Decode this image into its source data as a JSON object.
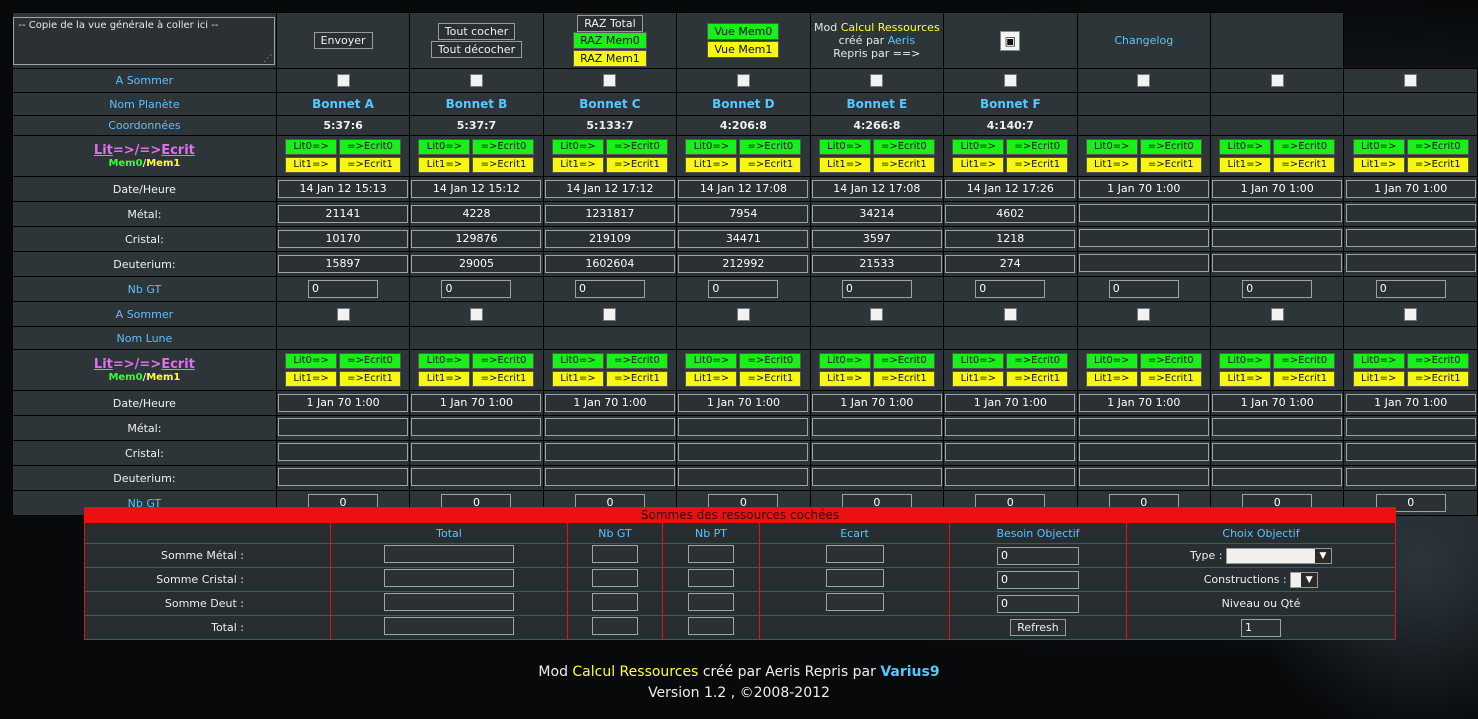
{
  "top": {
    "paste_placeholder": "-- Copie de la vue générale à coller ici --",
    "send": "Envoyer",
    "check_all": "Tout cocher",
    "uncheck_all": "Tout décocher",
    "raz_total": "RAZ Total",
    "raz_mem0": "RAZ Mem0",
    "raz_mem1": "RAZ Mem1",
    "vue_mem0": "Vue Mem0",
    "vue_mem1": "Vue Mem1",
    "mod_word": "Mod",
    "mod_name": "Calcul Ressources",
    "created_by": "créé par",
    "author": "Aeris",
    "taken_by": "Repris par ==>",
    "changelog": "Changelog",
    "export_icon": "image-icon"
  },
  "labels": {
    "sum": "A Sommer",
    "planet_name": "Nom Planète",
    "coords": "Coordonnées",
    "lit": "Lit",
    "arrows": "=>/=>",
    "ecrit": "Ecrit",
    "mem0": "Mem0",
    "slash": "/",
    "mem1": "Mem1",
    "date": "Date/Heure",
    "metal": "Métal:",
    "crystal": "Cristal:",
    "deut": "Deuterium:",
    "nbgt": "Nb GT",
    "moon_name": "Nom Lune"
  },
  "mem_buttons": {
    "lit0": "Lit0=>",
    "ecrit0": "=>Ecrit0",
    "lit1": "Lit1=>",
    "ecrit1": "=>Ecrit1"
  },
  "planets": [
    {
      "name": "Bonnet A",
      "coords": "5:37:6",
      "date": "14 Jan 12  15:13",
      "metal": "21141",
      "crystal": "10170",
      "deut": "15897",
      "nbgt": "0"
    },
    {
      "name": "Bonnet B",
      "coords": "5:37:7",
      "date": "14 Jan 12  15:12",
      "metal": "4228",
      "crystal": "129876",
      "deut": "29005",
      "nbgt": "0"
    },
    {
      "name": "Bonnet C",
      "coords": "5:133:7",
      "date": "14 Jan 12  17:12",
      "metal": "1231817",
      "crystal": "219109",
      "deut": "1602604",
      "nbgt": "0"
    },
    {
      "name": "Bonnet D",
      "coords": "4:206:8",
      "date": "14 Jan 12  17:08",
      "metal": "7954",
      "crystal": "34471",
      "deut": "212992",
      "nbgt": "0"
    },
    {
      "name": "Bonnet E",
      "coords": "4:266:8",
      "date": "14 Jan 12  17:08",
      "metal": "34214",
      "crystal": "3597",
      "deut": "21533",
      "nbgt": "0"
    },
    {
      "name": "Bonnet F",
      "coords": "4:140:7",
      "date": "14 Jan 12  17:26",
      "metal": "4602",
      "crystal": "1218",
      "deut": "274",
      "nbgt": "0"
    },
    {
      "name": "",
      "coords": "",
      "date": "1 Jan 70  1:00",
      "metal": "",
      "crystal": "",
      "deut": "",
      "nbgt": "0"
    },
    {
      "name": "",
      "coords": "",
      "date": "1 Jan 70  1:00",
      "metal": "",
      "crystal": "",
      "deut": "",
      "nbgt": "0"
    },
    {
      "name": "",
      "coords": "",
      "date": "1 Jan 70  1:00",
      "metal": "",
      "crystal": "",
      "deut": "",
      "nbgt": "0"
    }
  ],
  "moons": [
    {
      "date": "1 Jan 70  1:00",
      "nbgt": "0"
    },
    {
      "date": "1 Jan 70  1:00",
      "nbgt": "0"
    },
    {
      "date": "1 Jan 70  1:00",
      "nbgt": "0"
    },
    {
      "date": "1 Jan 70  1:00",
      "nbgt": "0"
    },
    {
      "date": "1 Jan 70  1:00",
      "nbgt": "0"
    },
    {
      "date": "1 Jan 70  1:00",
      "nbgt": "0"
    },
    {
      "date": "1 Jan 70  1:00",
      "nbgt": "0"
    },
    {
      "date": "1 Jan 70  1:00",
      "nbgt": "0"
    },
    {
      "date": "1 Jan 70  1:00",
      "nbgt": "0"
    }
  ],
  "summary": {
    "title": "Sommes des ressources cochées",
    "cols": {
      "total": "Total",
      "nbgt": "Nb GT",
      "nbpt": "Nb PT",
      "ecart": "Ecart",
      "besoin": "Besoin Objectif",
      "choix": "Choix Objectif"
    },
    "rows": {
      "metal": "Somme Métal :",
      "crystal": "Somme Cristal :",
      "deut": "Somme Deut :",
      "total": "Total :"
    },
    "besoin_values": [
      "0",
      "0",
      "0"
    ],
    "type_label": "Type :",
    "constructions_label": "Constructions :",
    "niveau_label": "Niveau ou Qté",
    "refresh": "Refresh",
    "qty_value": "1"
  },
  "footer": {
    "mod": "Mod",
    "name": "Calcul Ressources",
    "created": "créé par Aeris Repris par",
    "author2": "Varius9",
    "version": "Version 1.2 , ©2008-2012"
  }
}
